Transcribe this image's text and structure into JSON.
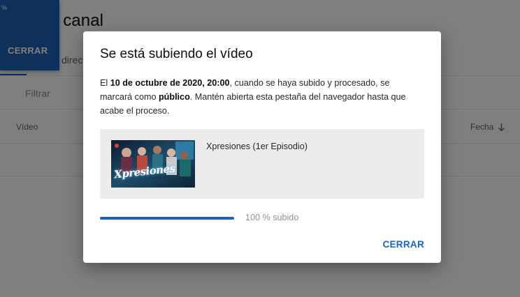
{
  "background": {
    "page_title": "l canal",
    "tab_partial": "direc",
    "filter_placeholder": "Filtrar",
    "columns": {
      "video": "Vídeo",
      "date": "Fecha"
    }
  },
  "toast": {
    "mark": "%",
    "close_label": "CERRAR"
  },
  "dialog": {
    "title": "Se está subiendo el vídeo",
    "body": {
      "p1": "El ",
      "date_bold": "10 de octubre de 2020, 20:00",
      "p2": ", cuando se haya subido y procesado, se marcará como ",
      "visibility_bold": "público",
      "p3": ". Mantén abierta esta pestaña del navegador hasta que acabe el proceso."
    },
    "video": {
      "title": "Xpresiones (1er Episodio)",
      "thumbnail_text": "Xpresiones"
    },
    "progress": {
      "percent": 100,
      "label": "100 % subido"
    },
    "close_label": "CERRAR"
  },
  "colors": {
    "accent": "#1c62b9",
    "scrim": "rgba(0,0,0,0.5)"
  }
}
